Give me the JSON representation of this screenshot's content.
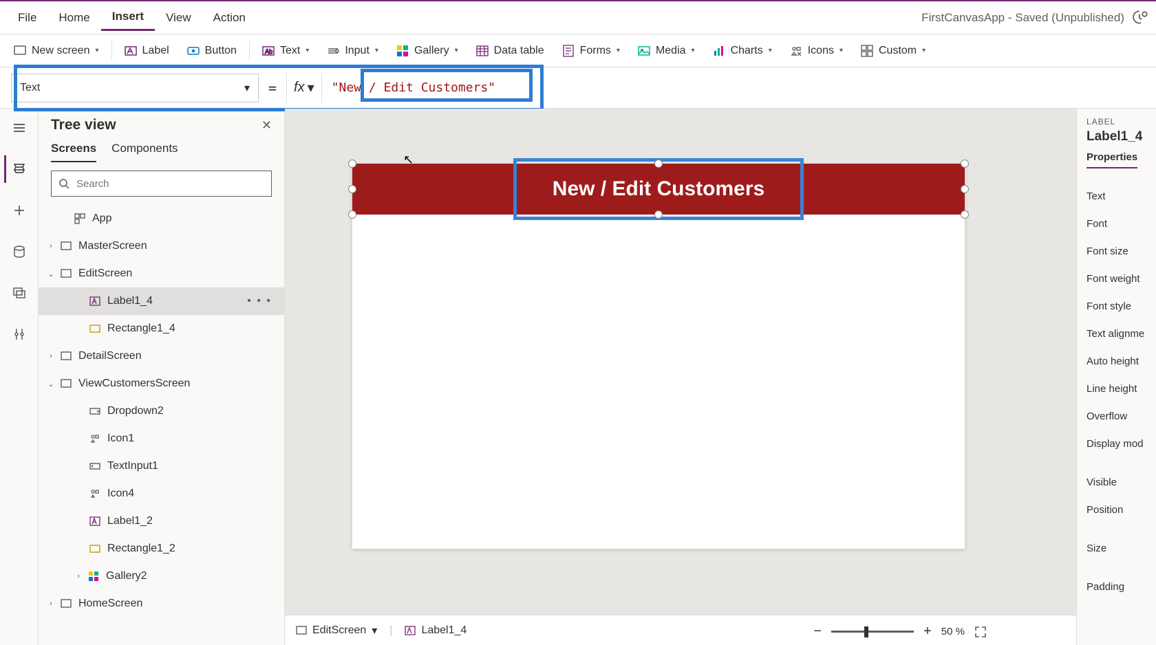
{
  "app_title": "FirstCanvasApp - Saved (Unpublished)",
  "menu": {
    "file": "File",
    "home": "Home",
    "insert": "Insert",
    "view": "View",
    "action": "Action"
  },
  "ribbon": {
    "new_screen": "New screen",
    "label": "Label",
    "button": "Button",
    "text": "Text",
    "input": "Input",
    "gallery": "Gallery",
    "data_table": "Data table",
    "forms": "Forms",
    "media": "Media",
    "charts": "Charts",
    "icons": "Icons",
    "custom": "Custom"
  },
  "formula": {
    "property": "Text",
    "equals": "=",
    "fx": "fx",
    "value": "\"New / Edit Customers\""
  },
  "tree": {
    "title": "Tree view",
    "tabs": {
      "screens": "Screens",
      "components": "Components"
    },
    "search_placeholder": "Search",
    "nodes": {
      "app": "App",
      "master": "MasterScreen",
      "edit": "EditScreen",
      "label14": "Label1_4",
      "rect14": "Rectangle1_4",
      "detail": "DetailScreen",
      "viewcust": "ViewCustomersScreen",
      "dropdown2": "Dropdown2",
      "icon1": "Icon1",
      "textinput1": "TextInput1",
      "icon4": "Icon4",
      "label12": "Label1_2",
      "rect12": "Rectangle1_2",
      "gallery2": "Gallery2",
      "home": "HomeScreen"
    }
  },
  "canvas": {
    "header_text": "New / Edit Customers"
  },
  "breadcrumb": {
    "screen": "EditScreen",
    "control": "Label1_4"
  },
  "props": {
    "caption": "LABEL",
    "name": "Label1_4",
    "tab": "Properties",
    "rows": [
      "Text",
      "Font",
      "Font size",
      "Font weight",
      "Font style",
      "Text alignme",
      "Auto height",
      "Line height",
      "Overflow",
      "Display mod",
      "",
      "Visible",
      "Position",
      "",
      "Size",
      "",
      "Padding"
    ]
  },
  "zoom": {
    "value": "50",
    "pct": "%"
  }
}
